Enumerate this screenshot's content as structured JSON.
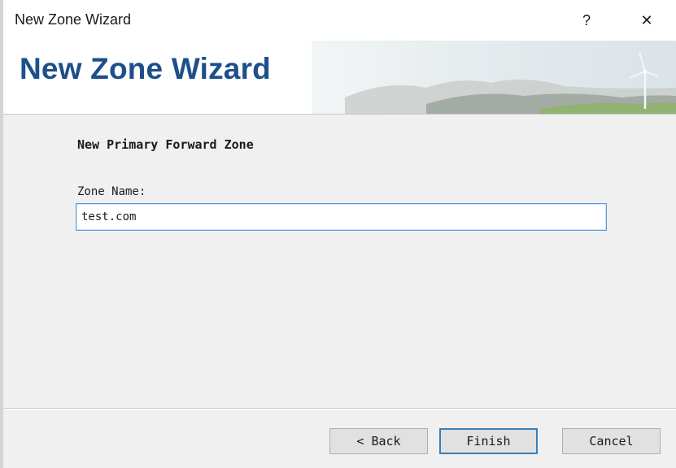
{
  "window": {
    "title": "New Zone Wizard",
    "help_glyph": "?",
    "close_glyph": "✕"
  },
  "banner": {
    "title": "New Zone Wizard"
  },
  "page": {
    "heading": "New Primary Forward Zone",
    "zone_name_label": "Zone Name:",
    "zone_name_value": "test.com"
  },
  "buttons": {
    "back": "< Back",
    "finish": "Finish",
    "cancel": "Cancel"
  },
  "colors": {
    "banner_title": "#1d4f8a",
    "focus_border": "#3c7fb1"
  }
}
